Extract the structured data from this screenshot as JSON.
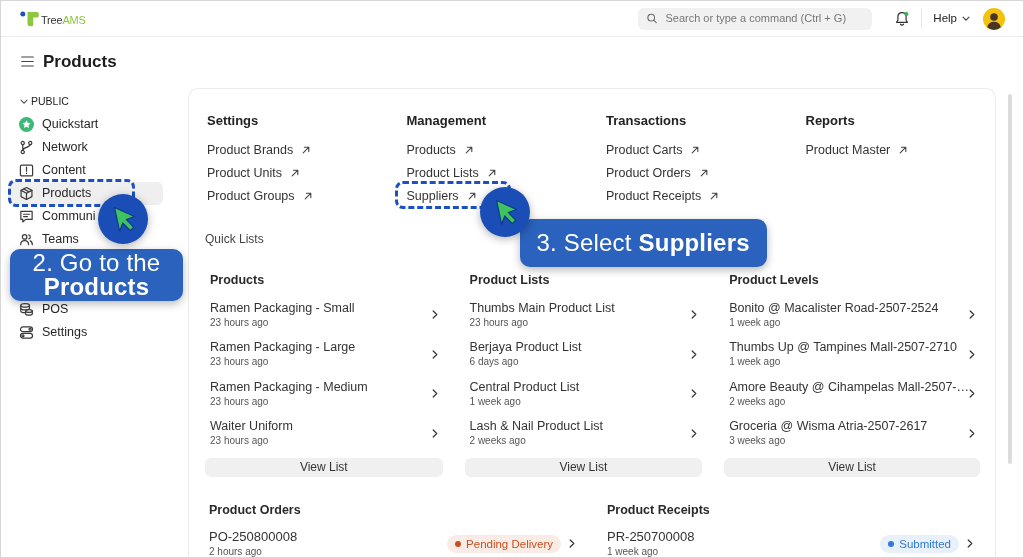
{
  "topbar": {
    "logo": {
      "text": "Tree",
      "accent": "AMS"
    },
    "search": {
      "placeholder": "Search or type a command (Ctrl + G)"
    },
    "notifications": {
      "unread": true
    },
    "help": "Help"
  },
  "page": {
    "title": "Products"
  },
  "sidebar": {
    "section": {
      "label": "PUBLIC",
      "expanded": true
    },
    "entries": [
      {
        "kind": "item",
        "label": "Quickstart",
        "selected": false,
        "highlighted": false,
        "pointer": false
      },
      {
        "kind": "item",
        "label": "Network",
        "selected": false,
        "highlighted": false,
        "pointer": false
      },
      {
        "kind": "item",
        "label": "Content",
        "selected": false,
        "highlighted": false,
        "pointer": false
      },
      {
        "kind": "item",
        "label": "Products",
        "selected": true,
        "highlighted": true,
        "pointer": true
      },
      {
        "kind": "item",
        "label": "Communi",
        "selected": false,
        "highlighted": false,
        "pointer": false
      },
      {
        "kind": "item",
        "label": "Teams",
        "selected": false,
        "highlighted": false,
        "pointer": false
      },
      {
        "kind": "callout",
        "text": "2. Go to the **Products**"
      },
      {
        "kind": "item",
        "label": "POS",
        "selected": false,
        "highlighted": false,
        "pointer": false
      },
      {
        "kind": "item",
        "label": "Settings",
        "selected": false,
        "highlighted": false,
        "pointer": false
      }
    ]
  },
  "shortcuts": {
    "columns": [
      {
        "title": "Settings",
        "links": [
          {
            "label": "Product Brands",
            "highlighted": false,
            "pointer": false
          },
          {
            "label": "Product Units",
            "highlighted": false,
            "pointer": false
          },
          {
            "label": "Product Groups",
            "highlighted": false,
            "pointer": false
          }
        ]
      },
      {
        "title": "Management",
        "links": [
          {
            "label": "Products",
            "highlighted": false,
            "pointer": false
          },
          {
            "label": "Product Lists",
            "highlighted": false,
            "pointer": false
          },
          {
            "label": "Suppliers",
            "highlighted": true,
            "pointer": true,
            "callout": "3. Select **Suppliers**"
          }
        ]
      },
      {
        "title": "Transactions",
        "links": [
          {
            "label": "Product Carts",
            "highlighted": false,
            "pointer": false
          },
          {
            "label": "Product Orders",
            "highlighted": false,
            "pointer": false
          },
          {
            "label": "Product Receipts",
            "highlighted": false,
            "pointer": false
          }
        ]
      },
      {
        "title": "Reports",
        "links": [
          {
            "label": "Product Master",
            "highlighted": false,
            "pointer": false
          }
        ]
      }
    ]
  },
  "quick_lists": {
    "title": "Quick Lists",
    "lists": [
      {
        "title": "Products",
        "items": [
          {
            "name": "Ramen Packaging - Small",
            "time": "23 hours ago"
          },
          {
            "name": "Ramen Packaging - Large",
            "time": "23 hours ago"
          },
          {
            "name": "Ramen Packaging - Medium",
            "time": "23 hours ago"
          },
          {
            "name": "Waiter Uniform",
            "time": "23 hours ago"
          }
        ],
        "button": "View List"
      },
      {
        "title": "Product Lists",
        "items": [
          {
            "name": "Thumbs Main Product List",
            "time": "23 hours ago"
          },
          {
            "name": "Berjaya Product List",
            "time": "6 days ago"
          },
          {
            "name": "Central Product List",
            "time": "1 week ago"
          },
          {
            "name": "Lash & Nail Product List",
            "time": "2 weeks ago"
          }
        ],
        "button": "View List"
      },
      {
        "title": "Product Levels",
        "items": [
          {
            "name": "Bonito @ Macalister Road-2507-2524",
            "time": "1 week ago"
          },
          {
            "name": "Thumbs Up @ Tampines Mall-2507-2710",
            "time": "1 week ago"
          },
          {
            "name": "Amore Beauty @ Cihampelas Mall-2507-…",
            "time": "2 weeks ago"
          },
          {
            "name": "Groceria @ Wisma Atria-2507-2617",
            "time": "3 weeks ago"
          }
        ],
        "button": "View List"
      }
    ]
  },
  "recent": [
    {
      "title": "Product Orders",
      "rows": [
        {
          "id": "PO-250800008",
          "time": "2 hours ago",
          "status": {
            "label": "Pending Delivery",
            "color": "#c8501e"
          }
        }
      ]
    },
    {
      "title": "Product Receipts",
      "rows": [
        {
          "id": "PR-250700008",
          "time": "1 week ago",
          "status": {
            "label": "Submitted",
            "color": "#2f7ad6"
          }
        }
      ]
    }
  ]
}
